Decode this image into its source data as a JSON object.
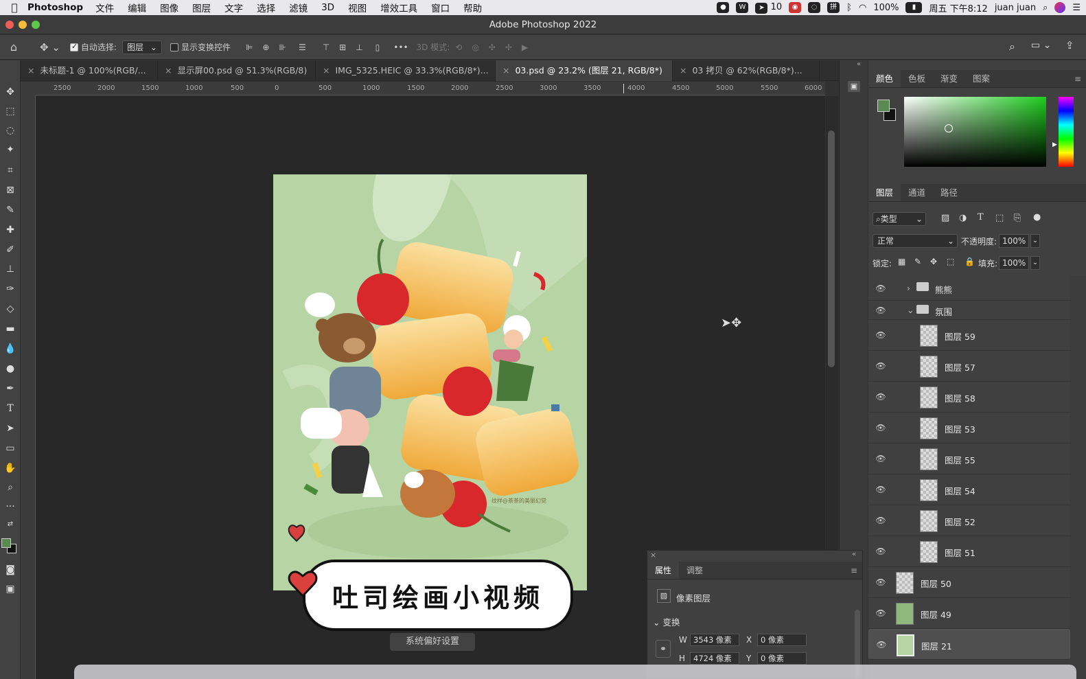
{
  "menubar": {
    "app_name": "Photoshop",
    "items": [
      "文件",
      "编辑",
      "图像",
      "图层",
      "文字",
      "选择",
      "滤镜",
      "3D",
      "视图",
      "增效工具",
      "窗口",
      "帮助"
    ],
    "status": {
      "badge_count": "10",
      "battery": "100%",
      "datetime": "周五 下午8:12",
      "user": "juan juan"
    }
  },
  "window": {
    "title": "Adobe Photoshop 2022"
  },
  "options": {
    "auto_select_label": "自动选择:",
    "auto_select_value": "图层",
    "show_transform_label": "显示变换控件",
    "mode_3d_label": "3D 模式:",
    "more": "•••"
  },
  "tabs": [
    {
      "label": "未标题-1 @ 100%(RGB/..."
    },
    {
      "label": "显示屏00.psd @ 51.3%(RGB/8)"
    },
    {
      "label": "IMG_5325.HEIC @ 33.3%(RGB/8*)..."
    },
    {
      "label": "03.psd @ 23.2% (图层 21, RGB/8*)"
    },
    {
      "label": "03 拷贝 @ 62%(RGB/8*)..."
    }
  ],
  "ruler": {
    "ticks": [
      "2500",
      "2000",
      "1500",
      "1000",
      "500",
      "0",
      "500",
      "1000",
      "1500",
      "2000",
      "2500",
      "3000",
      "3500",
      "4000",
      "4500",
      "5000",
      "5500",
      "6000"
    ]
  },
  "artwork": {
    "caption": "吐司绘画小视频",
    "signature": "纹样@茶茶的美丽幻觉",
    "tooltip": "系统偏好设置"
  },
  "colors": {
    "accent_green": "#5a8a52",
    "artwork_bg": "#b6d4a4",
    "toast": "#f3b24a",
    "cherry": "#d8282c"
  },
  "color_panel": {
    "tabs": [
      "颜色",
      "色板",
      "渐变",
      "图案"
    ]
  },
  "layers_panel": {
    "tabs": [
      "图层",
      "通道",
      "路径"
    ],
    "filter_label": "类型",
    "blend_mode": "正常",
    "opacity_label": "不透明度:",
    "opacity_value": "100%",
    "lock_label": "锁定:",
    "fill_label": "填充:",
    "fill_value": "100%",
    "groups": [
      {
        "name": "熊熊"
      },
      {
        "name": "氛围"
      }
    ],
    "layers": [
      {
        "name": "图层 59"
      },
      {
        "name": "图层 57"
      },
      {
        "name": "图层 58"
      },
      {
        "name": "图层 53"
      },
      {
        "name": "图层 55"
      },
      {
        "name": "图层 54"
      },
      {
        "name": "图层 52"
      },
      {
        "name": "图层 51"
      },
      {
        "name": "图层 50"
      },
      {
        "name": "图层 49"
      },
      {
        "name": "图层 21"
      }
    ]
  },
  "properties_panel": {
    "tabs": [
      "属性",
      "调整"
    ],
    "type_label": "像素图层",
    "section": "变换",
    "w_label": "W",
    "w_value": "3543 像素",
    "h_label": "H",
    "h_value": "4724 像素",
    "x_label": "X",
    "x_value": "0 像素",
    "y_label": "Y",
    "y_value": "0 像素"
  }
}
